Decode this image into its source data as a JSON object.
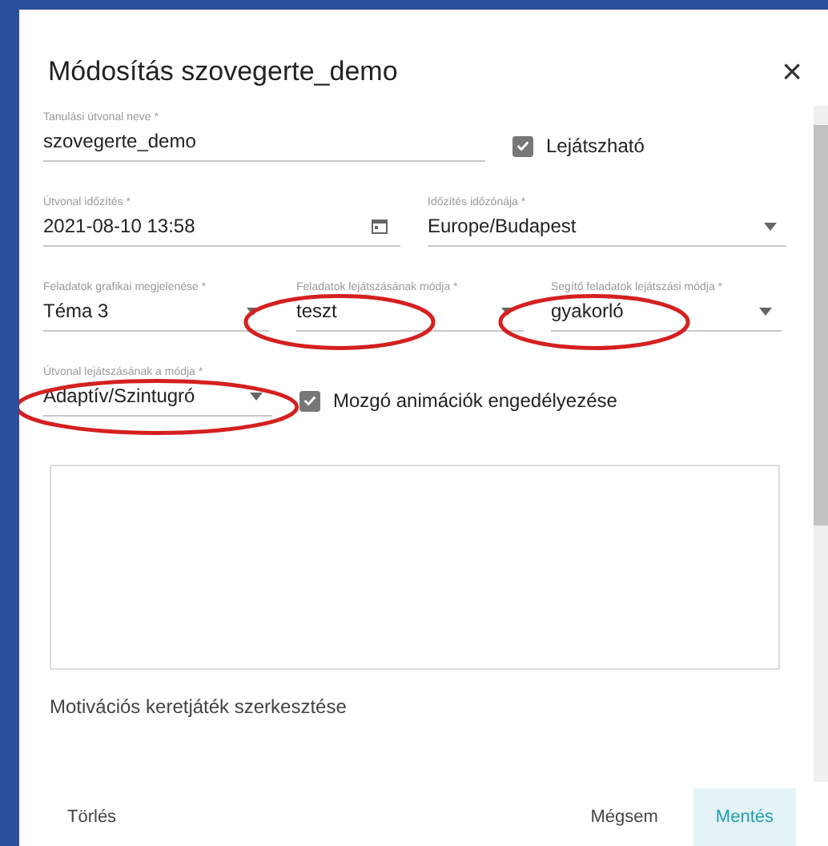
{
  "dialog": {
    "title": "Módosítás szovegerte_demo",
    "close": "×"
  },
  "rows": [
    {
      "fields": [
        {
          "kind": "text",
          "label": "Tanulási útvonal neve *",
          "value": "szovegerte_demo",
          "circled": false
        }
      ],
      "checkbox": {
        "label": "Lejátszható",
        "checked": true
      }
    },
    {
      "fields": [
        {
          "kind": "date",
          "label": "Útvonal időzítés *",
          "value": "2021-08-10 13:58",
          "circled": false
        },
        {
          "kind": "select",
          "label": "Időzítés időzónája *",
          "value": "Europe/Budapest",
          "circled": false
        }
      ]
    },
    {
      "fields": [
        {
          "kind": "select",
          "label": "Feladatok grafikai megjelenése *",
          "value": "Téma 3",
          "circled": false
        },
        {
          "kind": "select",
          "label": "Feladatok lejátszásának módja *",
          "value": "teszt",
          "circled": true
        },
        {
          "kind": "select",
          "label": "Segítő feladatok lejátszási módja *",
          "value": "gyakorló",
          "circled": true
        }
      ]
    },
    {
      "fields": [
        {
          "kind": "select",
          "label": "Útvonal lejátszásának a módja *",
          "value": "Adaptív/Szintugró",
          "circled": true
        }
      ],
      "checkbox": {
        "label": "Mozgó animációk engedélyezése",
        "checked": true
      }
    }
  ],
  "section_label": "Motivációs keretjáték szerkesztése",
  "buttons": [
    {
      "label": "Törlés",
      "kind": "text"
    },
    {
      "label": "Mégsem",
      "kind": "text"
    },
    {
      "label": "Mentés",
      "kind": "primary"
    }
  ]
}
